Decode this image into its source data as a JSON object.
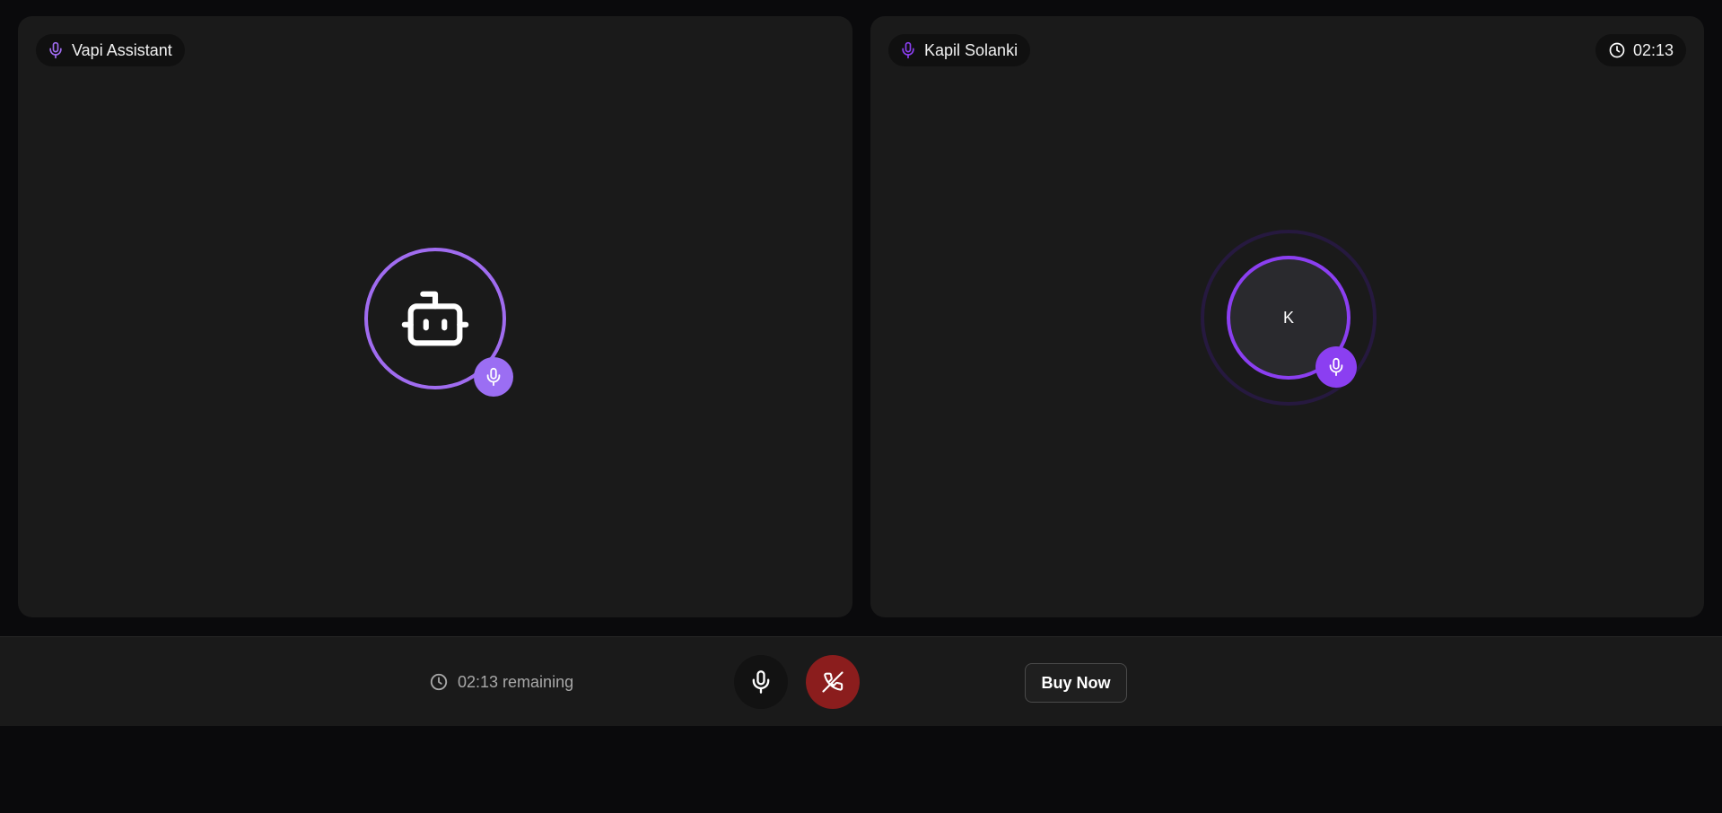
{
  "assistant_tile": {
    "name": "Vapi Assistant",
    "mic_icon": "mic-icon",
    "avatar_icon": "bot-icon",
    "accent_color": "#a06cf0"
  },
  "user_tile": {
    "name": "Kapil Solanki",
    "initial": "K",
    "timer": "02:13",
    "timer_icon": "clock-icon",
    "accent_color": "#8b3ff1"
  },
  "controls": {
    "remaining_text": "02:13 remaining",
    "mic_button_icon": "mic-icon",
    "end_call_icon": "phone-off-icon",
    "end_call_color": "#8b1d1d",
    "buy_label": "Buy Now"
  }
}
